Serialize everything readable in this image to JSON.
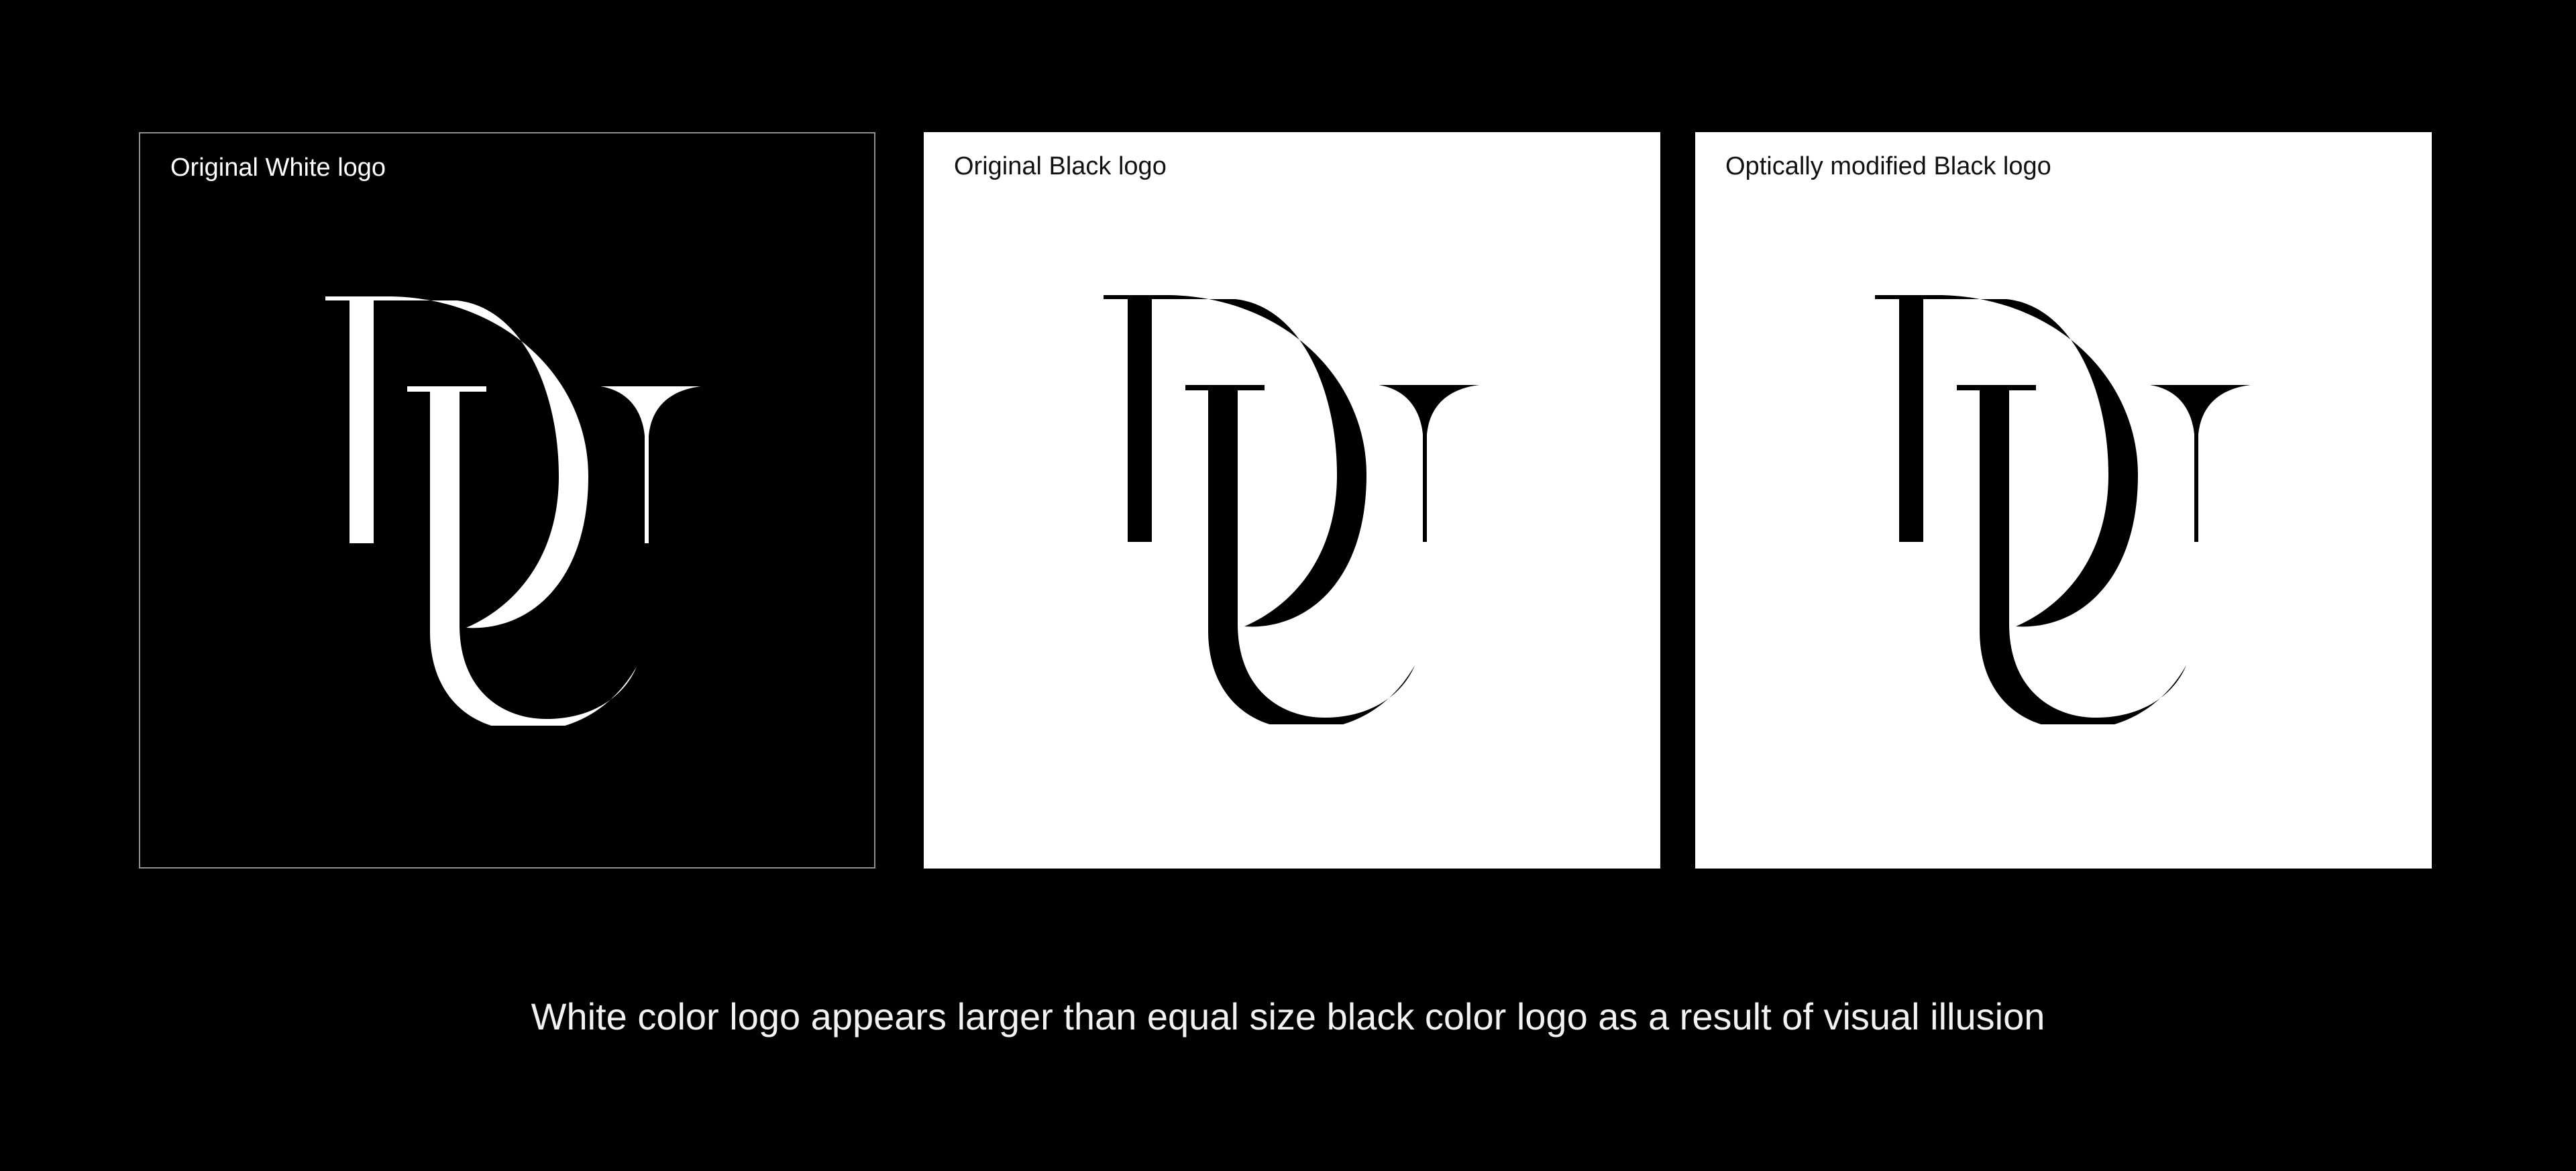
{
  "panels": [
    {
      "label": "Original White logo",
      "background": "#000000",
      "logo_color": "#ffffff",
      "border_color": "#8f8f8f"
    },
    {
      "label": "Original Black logo",
      "background": "#ffffff",
      "logo_color": "#000000"
    },
    {
      "label": "Optically modified Black logo",
      "background": "#ffffff",
      "logo_color": "#000000"
    }
  ],
  "caption": "White color logo appears larger than equal size black color logo as a result of visual illusion",
  "logo_icon": "dc-monogram-logo"
}
